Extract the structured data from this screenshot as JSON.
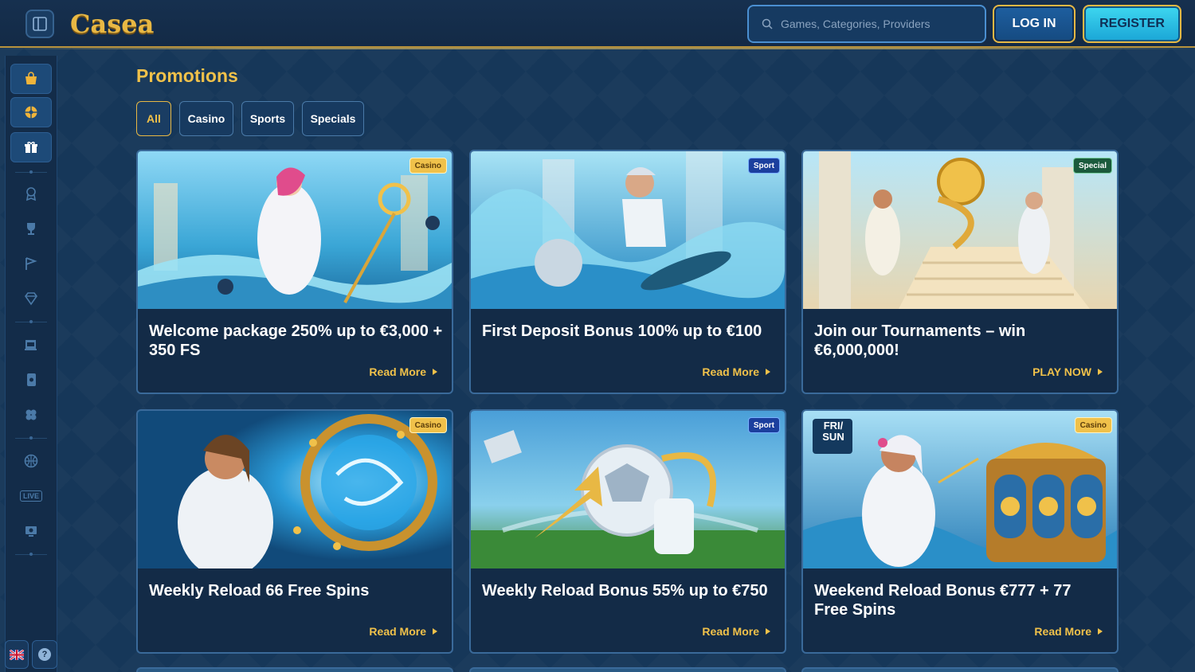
{
  "header": {
    "logo_text": "Casea",
    "search_placeholder": "Games, Categories, Providers",
    "login_label": "LOG IN",
    "register_label": "REGISTER"
  },
  "sidebar": {
    "icons": [
      "shop-icon",
      "wheel-icon",
      "gift-icon",
      "badge-icon",
      "trophy-icon",
      "flag-icon",
      "diamond-icon",
      "slot-icon",
      "card-icon",
      "clover-icon",
      "basketball-icon",
      "live-icon",
      "tv-icon"
    ],
    "live_label": "LIVE",
    "help_label": "?"
  },
  "page": {
    "title": "Promotions",
    "filters": [
      "All",
      "Casino",
      "Sports",
      "Specials"
    ],
    "active_filter": "All"
  },
  "promotions": [
    {
      "badge": "Casino",
      "title": "Welcome package 250% up to €3,000 + 350 FS",
      "link": "Read More"
    },
    {
      "badge": "Sport",
      "title": "First Deposit Bonus 100% up to €100",
      "link": "Read More"
    },
    {
      "badge": "Special",
      "title": "Join our Tournaments – win €6,000,000!",
      "link": "PLAY NOW"
    },
    {
      "badge": "Casino",
      "title": "Weekly Reload 66 Free Spins",
      "link": "Read More"
    },
    {
      "badge": "Sport",
      "title": "Weekly Reload Bonus 55% up to €750",
      "link": "Read More"
    },
    {
      "badge": "Casino",
      "title": "Weekend Reload Bonus €777 + 77 Free Spins",
      "link": "Read More",
      "overlay": "FRI/ SUN"
    }
  ],
  "colors": {
    "accent_gold": "#f0c14a",
    "background": "#15365a",
    "register_cyan": "#3ed7f0"
  }
}
